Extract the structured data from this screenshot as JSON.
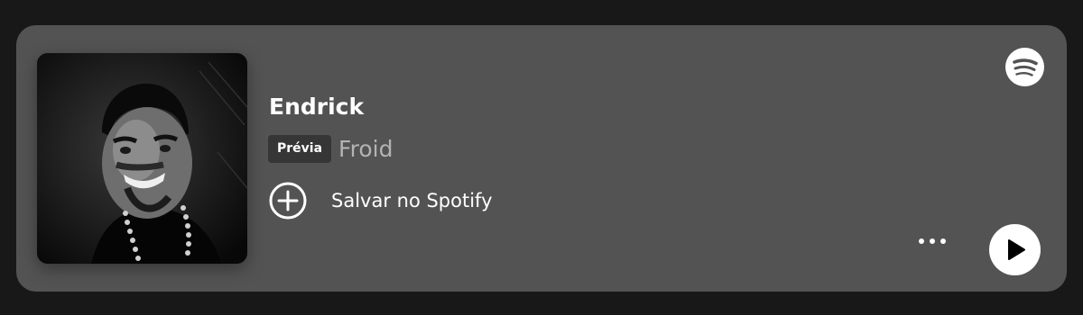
{
  "track": {
    "title": "Endrick",
    "badge": "Prévia",
    "artist": "Froid",
    "cover_alt": "cover-art"
  },
  "actions": {
    "save_label": "Salvar no Spotify",
    "save_icon": "add-circle-icon",
    "more_icon": "more-dots-icon",
    "play_icon": "play-icon"
  },
  "brand": {
    "logo": "spotify-icon"
  },
  "colors": {
    "page_background": "#181818",
    "card_background": "#535353",
    "badge_background": "#363636",
    "text_primary": "#ffffff",
    "text_secondary": "#b3b3b3"
  }
}
